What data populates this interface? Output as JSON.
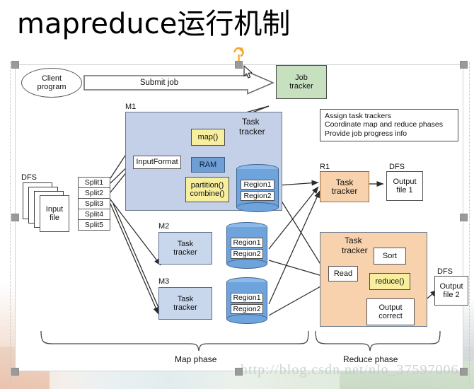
{
  "slide": {
    "title": "mapreduce运行机制",
    "watermark": "http://blog.csdn.net/nlo_37597006"
  },
  "colors": {
    "job_tracker_green": "#c6e0c0",
    "map_group_blue": "#c3d0e8",
    "reduce_group_orange": "#f8d2ad",
    "yellow_func": "#f7ef9d",
    "ram_blue": "#6e9ed4",
    "cylinder_blue": "#6fa3dc",
    "handle_gray": "#9a9a9a",
    "rotate_handle_orange": "#f5a623"
  },
  "diagram": {
    "client_program": "Client\nprogram",
    "client_program_line1": "Client",
    "client_program_line2": "program",
    "submit_job": "Submit job",
    "job_tracker_line1": "Job",
    "job_tracker_line2": "tracker",
    "callout": {
      "line1": "Assign task trackers",
      "line2": "Coordinate map and reduce phases",
      "line3": "Provide job progress info"
    },
    "dfs_left_label": "DFS",
    "input_file_line1": "Input",
    "input_file_line2": "file",
    "splits": [
      "Split1",
      "Split2",
      "Split3",
      "Split4",
      "Split5"
    ],
    "m1": {
      "label": "M1",
      "task_tracker_line1": "Task",
      "task_tracker_line2": "tracker",
      "input_format": "InputFormat",
      "map_fn": "map()",
      "ram": "RAM",
      "partition_line1": "partition()",
      "partition_line2": "combine()",
      "regions": [
        "Region1",
        "Region2"
      ]
    },
    "m2": {
      "label": "M2",
      "task_tracker_line1": "Task",
      "task_tracker_line2": "tracker",
      "regions": [
        "Region1",
        "Region2"
      ]
    },
    "m3": {
      "label": "M3",
      "task_tracker_line1": "Task",
      "task_tracker_line2": "tracker",
      "regions": [
        "Region1",
        "Region2"
      ]
    },
    "r1": {
      "label": "R1",
      "task_tracker_line1": "Task",
      "task_tracker_line2": "tracker",
      "dfs_label": "DFS",
      "output_line1": "Output",
      "output_line2": "file 1"
    },
    "r2": {
      "task_tracker_line1": "Task",
      "task_tracker_line2": "tracker",
      "read": "Read",
      "sort": "Sort",
      "reduce_fn": "reduce()",
      "output_correct_line1": "Output",
      "output_correct_line2": "correct",
      "dfs_label": "DFS",
      "output_line1": "Output",
      "output_line2": "file 2"
    },
    "map_phase": "Map phase",
    "reduce_phase": "Reduce phase"
  }
}
